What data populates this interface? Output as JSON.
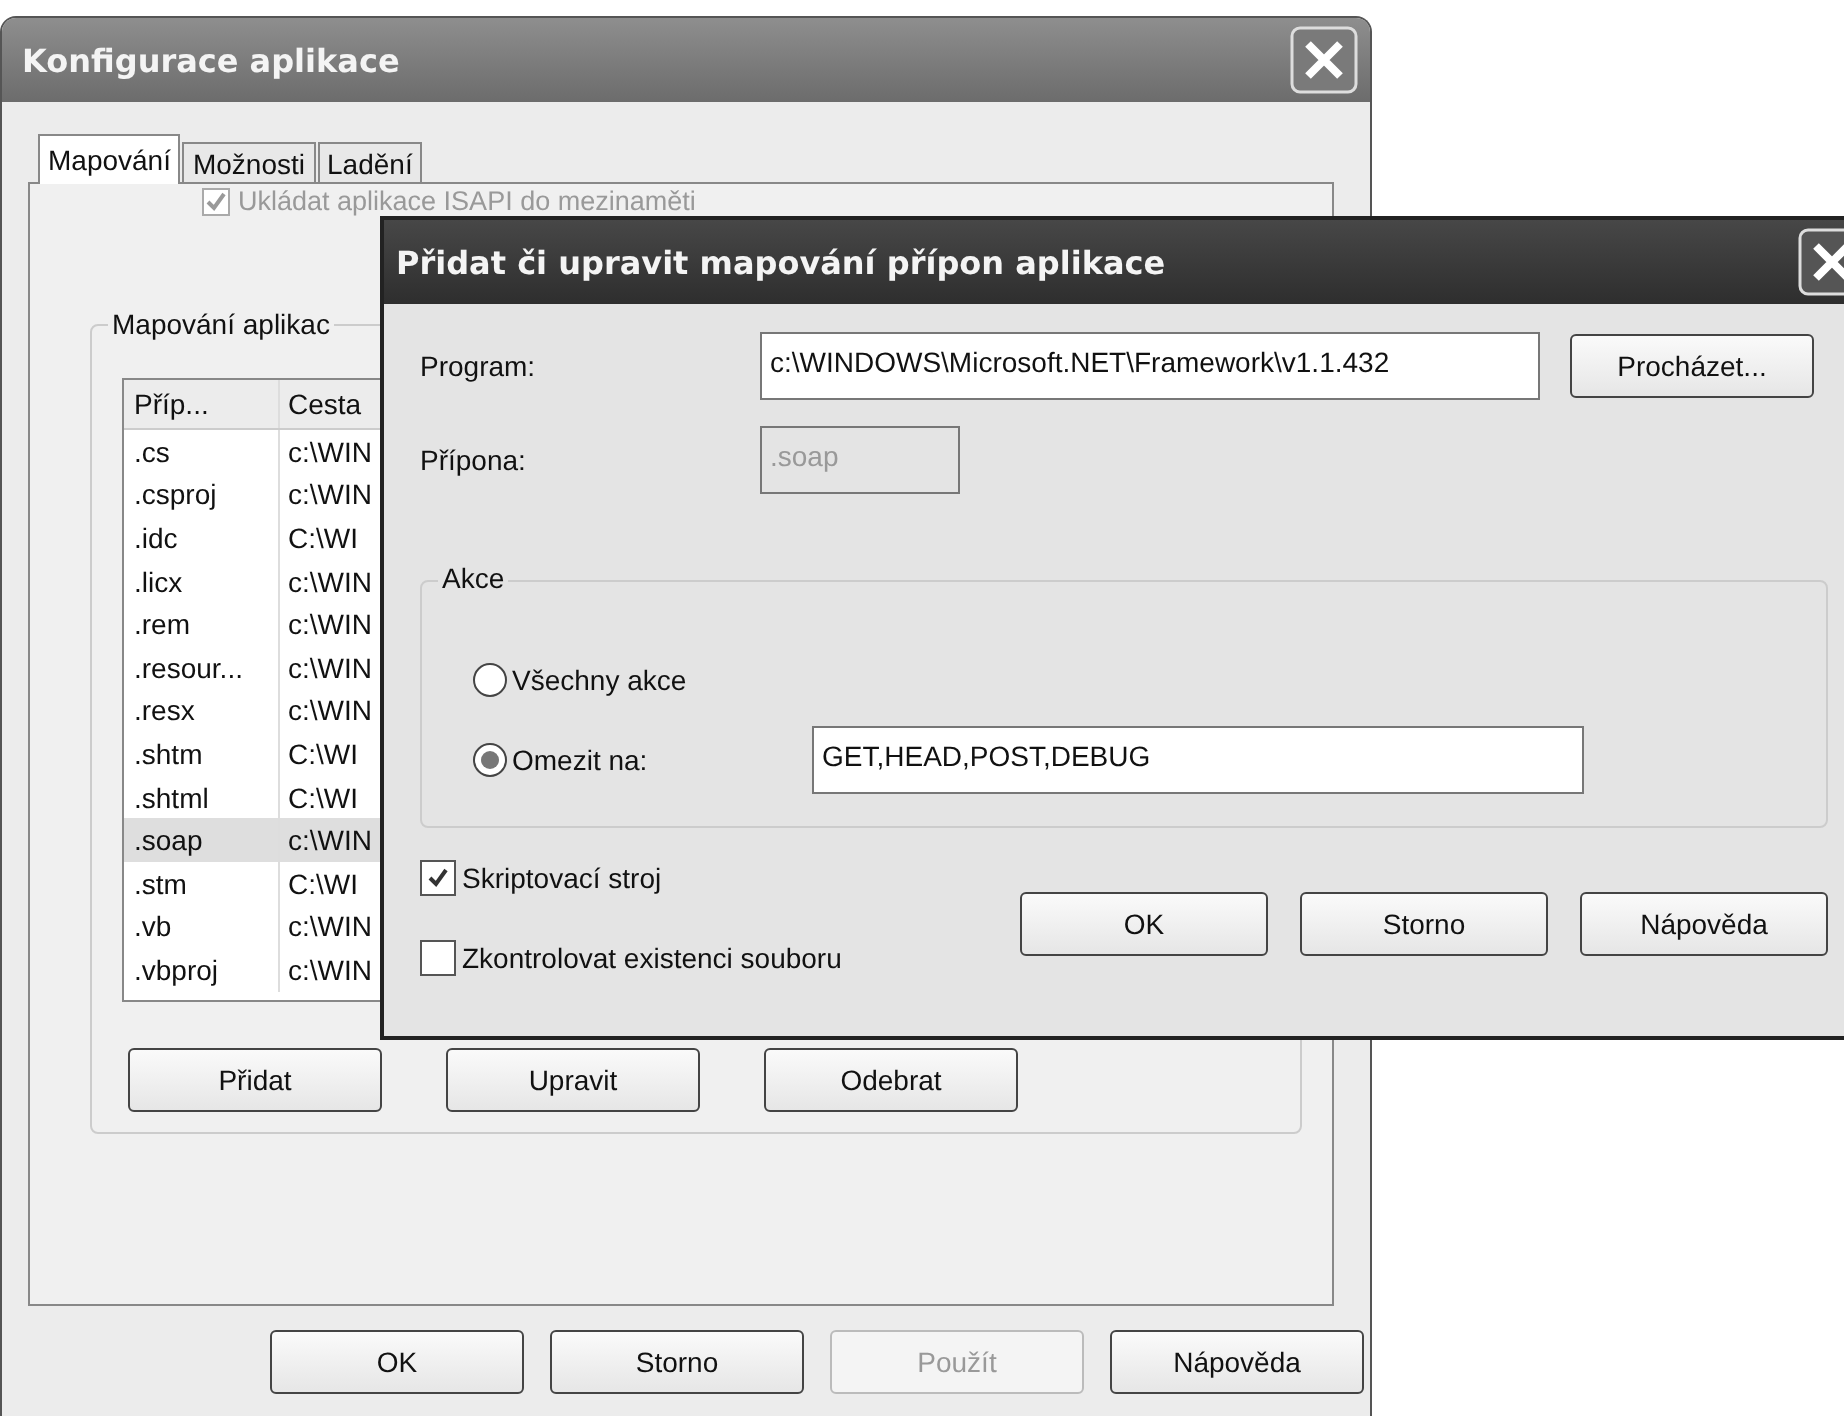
{
  "main_window": {
    "title": "Konfigurace aplikace",
    "tabs": [
      {
        "label": "Mapování",
        "selected": true
      },
      {
        "label": "Možnosti",
        "selected": false
      },
      {
        "label": "Ladění",
        "selected": false
      }
    ],
    "cache_checkbox": {
      "label": "Ukládat aplikace ISAPI do mezinaměti",
      "checked": true,
      "disabled": true
    },
    "group": {
      "title": "Mapování aplikac",
      "columns": [
        "Příp...",
        "Cesta"
      ],
      "rows": [
        {
          "cells": [
            ".cs",
            "c:\\WIN"
          ],
          "selected": false
        },
        {
          "cells": [
            ".csproj",
            "c:\\WIN"
          ],
          "selected": false
        },
        {
          "cells": [
            ".idc",
            "C:\\WI"
          ],
          "selected": false
        },
        {
          "cells": [
            ".licx",
            "c:\\WIN"
          ],
          "selected": false
        },
        {
          "cells": [
            ".rem",
            "c:\\WIN"
          ],
          "selected": false
        },
        {
          "cells": [
            ".resour...",
            "c:\\WIN"
          ],
          "selected": false
        },
        {
          "cells": [
            ".resx",
            "c:\\WIN"
          ],
          "selected": false
        },
        {
          "cells": [
            ".shtm",
            "C:\\WI"
          ],
          "selected": false
        },
        {
          "cells": [
            ".shtml",
            "C:\\WI"
          ],
          "selected": false
        },
        {
          "cells": [
            ".soap",
            "c:\\WIN"
          ],
          "selected": true
        },
        {
          "cells": [
            ".stm",
            "C:\\WI"
          ],
          "selected": false
        },
        {
          "cells": [
            ".vb",
            "c:\\WIN"
          ],
          "selected": false
        },
        {
          "cells": [
            ".vbproj",
            "c:\\WIN"
          ],
          "selected": false
        }
      ],
      "buttons": [
        "Přidat",
        "Upravit",
        "Odebrat"
      ]
    },
    "buttons": [
      {
        "label": "OK",
        "disabled": false
      },
      {
        "label": "Storno",
        "disabled": false
      },
      {
        "label": "Použít",
        "disabled": true
      },
      {
        "label": "Nápověda",
        "disabled": false
      }
    ]
  },
  "dialog": {
    "title": "Přidat či upravit mapování přípon aplikace",
    "fields": [
      {
        "label": "Program:",
        "value": "c:\\WINDOWS\\Microsoft.NET\\Framework\\v1.1.432",
        "disabled": false
      },
      {
        "label": "Přípona:",
        "value": ".soap",
        "disabled": true
      }
    ],
    "browse_button": "Procházet...",
    "actions": {
      "title": "Akce",
      "options": [
        {
          "label": "Všechny akce",
          "selected": false
        },
        {
          "label": "Omezit na:",
          "selected": true,
          "value": "GET,HEAD,POST,DEBUG"
        }
      ]
    },
    "checkboxes": [
      {
        "label": "Skriptovací stroj",
        "checked": true
      },
      {
        "label": "Zkontrolovat existenci souboru",
        "checked": false
      }
    ],
    "buttons": [
      "OK",
      "Storno",
      "Nápověda"
    ]
  }
}
